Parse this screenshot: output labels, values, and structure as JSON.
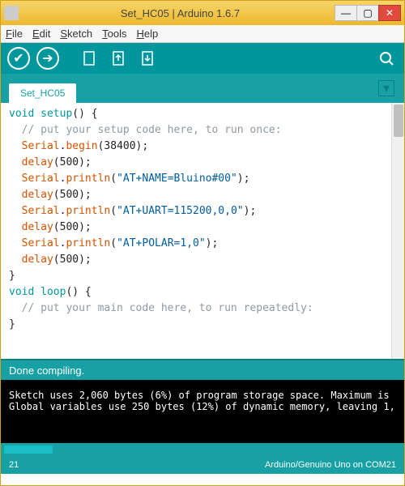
{
  "window": {
    "title": "Set_HC05 | Arduino 1.6.7"
  },
  "menu": {
    "file": "File",
    "edit": "Edit",
    "sketch": "Sketch",
    "tools": "Tools",
    "help": "Help"
  },
  "tabs": {
    "active": "Set_HC05"
  },
  "code": {
    "l01a": "void",
    "l01b": " ",
    "l01c": "setup",
    "l01d": "() {",
    "l02a": "  // put your setup code here, to run once:",
    "l03a": "  ",
    "l03b": "Serial",
    "l03c": ".",
    "l03d": "begin",
    "l03e": "(38400);",
    "l04a": "  ",
    "l04b": "delay",
    "l04c": "(500);",
    "l05a": "  ",
    "l05b": "Serial",
    "l05c": ".",
    "l05d": "println",
    "l05e": "(",
    "l05f": "\"AT+NAME=Bluino#00\"",
    "l05g": ");",
    "l06a": "  ",
    "l06b": "delay",
    "l06c": "(500);",
    "l07a": "  ",
    "l07b": "Serial",
    "l07c": ".",
    "l07d": "println",
    "l07e": "(",
    "l07f": "\"AT+UART=115200,0,0\"",
    "l07g": ");",
    "l08a": "  ",
    "l08b": "delay",
    "l08c": "(500);",
    "l09a": "  ",
    "l09b": "Serial",
    "l09c": ".",
    "l09d": "println",
    "l09e": "(",
    "l09f": "\"AT+POLAR=1,0\"",
    "l09g": ");",
    "l10a": "  ",
    "l10b": "delay",
    "l10c": "(500);",
    "l11a": "}",
    "l12a": "",
    "l13a": "void",
    "l13b": " ",
    "l13c": "loop",
    "l13d": "() {",
    "l14a": "  // put your main code here, to run repeatedly:",
    "l15a": "",
    "l16a": "}"
  },
  "status": {
    "message": "Done compiling."
  },
  "console": {
    "line1": "Sketch uses 2,060 bytes (6%) of program storage space. Maximum is ",
    "line2": "Global variables use 250 bytes (12%) of dynamic memory, leaving 1,"
  },
  "footer": {
    "left": "21",
    "right": "Arduino/Genuino Uno on COM21"
  },
  "icons": {
    "min": "—",
    "max": "▢",
    "close": "✕",
    "check": "✔",
    "arrow": "➔",
    "new": "▤",
    "up": "↑",
    "down": "↓",
    "serial": "🔍",
    "drop": "▾"
  }
}
